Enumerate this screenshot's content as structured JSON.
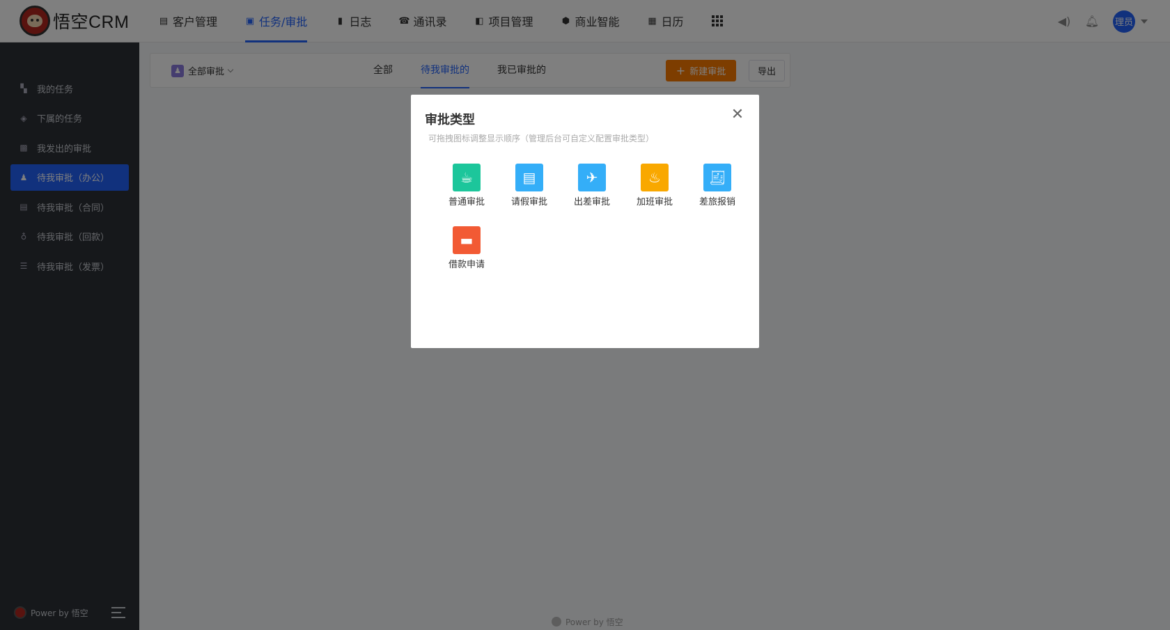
{
  "app": {
    "logo_text": "悟空CRM"
  },
  "nav": [
    {
      "label": "客户管理",
      "icon": "customer-icon",
      "active": false
    },
    {
      "label": "任务/审批",
      "icon": "briefcase-icon",
      "active": true
    },
    {
      "label": "日志",
      "icon": "journal-icon",
      "active": false
    },
    {
      "label": "通讯录",
      "icon": "contacts-icon",
      "active": false
    },
    {
      "label": "项目管理",
      "icon": "project-icon",
      "active": false
    },
    {
      "label": "商业智能",
      "icon": "bi-icon",
      "active": false
    },
    {
      "label": "日历",
      "icon": "calendar-icon",
      "active": false
    }
  ],
  "user": {
    "avatar_text": "理员"
  },
  "sidebar": {
    "items": [
      {
        "label": "我的任务",
        "icon": "dashboard-icon",
        "active": false
      },
      {
        "label": "下属的任务",
        "icon": "layers-icon",
        "active": false
      },
      {
        "label": "我发出的审批",
        "icon": "calendar-check-icon",
        "active": false
      },
      {
        "label": "待我审批（办公）",
        "icon": "stamp-icon",
        "active": true
      },
      {
        "label": "待我审批（合同）",
        "icon": "contract-icon",
        "active": false
      },
      {
        "label": "待我审批（回款）",
        "icon": "money-bag-icon",
        "active": false
      },
      {
        "label": "待我审批（发票）",
        "icon": "invoice-icon",
        "active": false
      }
    ],
    "footer_text": "Power by 悟空"
  },
  "toolbar": {
    "filter_label": "全部审批",
    "tabs": [
      {
        "label": "全部",
        "active": false
      },
      {
        "label": "待我审批的",
        "active": true
      },
      {
        "label": "我已审批的",
        "active": false
      }
    ],
    "new_button": "新建审批",
    "export_button": "导出"
  },
  "main_footer": "Power by 悟空",
  "modal": {
    "title": "审批类型",
    "subtitle": "可拖拽图标调整显示顺序（管理后台可自定义配置审批类型）",
    "types": [
      {
        "label": "普通审批",
        "icon": "coffee-icon",
        "color": "#1cc69b"
      },
      {
        "label": "请假审批",
        "icon": "calendar-icon",
        "color": "#34aef8"
      },
      {
        "label": "出差审批",
        "icon": "plane-icon",
        "color": "#34aef8"
      },
      {
        "label": "加班审批",
        "icon": "desk-lamp-icon",
        "color": "#f9a800"
      },
      {
        "label": "差旅报销",
        "icon": "receipt-icon",
        "color": "#34aef8"
      },
      {
        "label": "借款申请",
        "icon": "toolbox-icon",
        "color": "#f25a34"
      }
    ]
  },
  "colors": {
    "accent": "#2362fb",
    "sidebar_bg": "#2d3037",
    "new_button": "#fa7b00"
  }
}
